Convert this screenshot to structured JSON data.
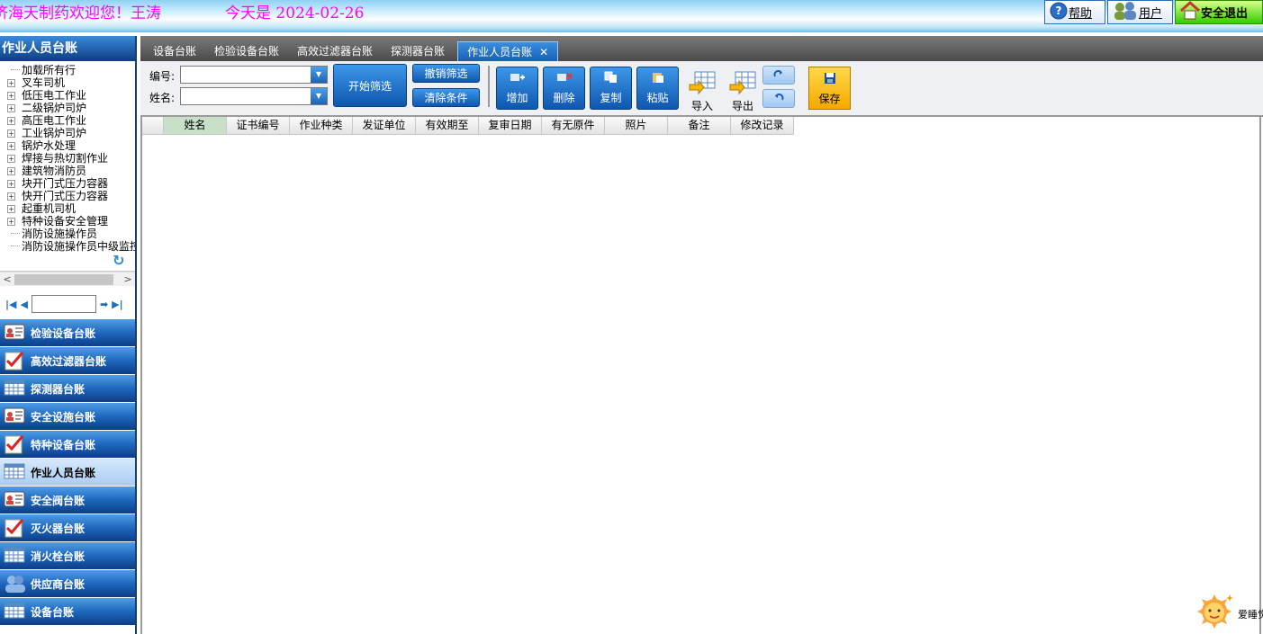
{
  "header": {
    "greeting": "济海天制药欢迎您！王涛",
    "today": "今天是 2024-02-26",
    "help_label": "帮助",
    "user_label": "用户",
    "logout_label": "安全退出"
  },
  "sidebar": {
    "title": "作业人员台账",
    "tree": [
      {
        "label": "加载所有行",
        "expandable": false
      },
      {
        "label": "叉车司机",
        "expandable": true
      },
      {
        "label": "低压电工作业",
        "expandable": true
      },
      {
        "label": "二级锅炉司炉",
        "expandable": true
      },
      {
        "label": "高压电工作业",
        "expandable": true
      },
      {
        "label": "工业锅炉司炉",
        "expandable": true
      },
      {
        "label": "锅炉水处理",
        "expandable": true
      },
      {
        "label": "焊接与热切割作业",
        "expandable": true
      },
      {
        "label": "建筑物消防员",
        "expandable": true
      },
      {
        "label": "块开门式压力容器",
        "expandable": true
      },
      {
        "label": "快开门式压力容器",
        "expandable": true
      },
      {
        "label": "起重机司机",
        "expandable": true
      },
      {
        "label": "特种设备安全管理",
        "expandable": true
      },
      {
        "label": "消防设施操作员",
        "expandable": false
      },
      {
        "label": "消防设施操作员中级监控",
        "expandable": false
      }
    ],
    "pager_value": "",
    "nav": [
      {
        "label": "检验设备台账",
        "icon": "id-card-icon",
        "active": false
      },
      {
        "label": "高效过滤器台账",
        "icon": "checklist-icon",
        "active": false
      },
      {
        "label": "探测器台账",
        "icon": "calendar-grid-icon",
        "active": false
      },
      {
        "label": "安全设施台账",
        "icon": "id-card-icon",
        "active": false
      },
      {
        "label": "特种设备台账",
        "icon": "checklist-icon",
        "active": false
      },
      {
        "label": "作业人员台账",
        "icon": "calendar-grid-icon",
        "active": true
      },
      {
        "label": "安全阀台账",
        "icon": "id-card-icon",
        "active": false
      },
      {
        "label": "灭火器台账",
        "icon": "checklist-icon",
        "active": false
      },
      {
        "label": "消火栓台账",
        "icon": "calendar-grid-icon",
        "active": false
      },
      {
        "label": "供应商台账",
        "icon": "people-icon",
        "active": false
      },
      {
        "label": "设备台账",
        "icon": "calendar-grid-icon",
        "active": false
      }
    ]
  },
  "tabs": [
    {
      "label": "设备台账",
      "active": false
    },
    {
      "label": "检验设备台账",
      "active": false
    },
    {
      "label": "高效过滤器台账",
      "active": false
    },
    {
      "label": "探测器台账",
      "active": false
    },
    {
      "label": "作业人员台账",
      "active": true
    }
  ],
  "filter": {
    "code_label": "编号:",
    "code_value": "",
    "name_label": "姓名:",
    "name_value": "",
    "start_label": "开始筛选",
    "cancel_label": "撤销筛选",
    "clear_label": "清除条件"
  },
  "actions": {
    "add": "增加",
    "delete": "删除",
    "copy": "复制",
    "paste": "粘贴",
    "import": "导入",
    "export": "导出",
    "save": "保存"
  },
  "grid": {
    "columns": [
      "姓名",
      "证书编号",
      "作业种类",
      "发证单位",
      "有效期至",
      "复审日期",
      "有无原件",
      "照片",
      "备注",
      "修改记录"
    ],
    "rows": []
  },
  "mascot_label": "爱睡觉"
}
